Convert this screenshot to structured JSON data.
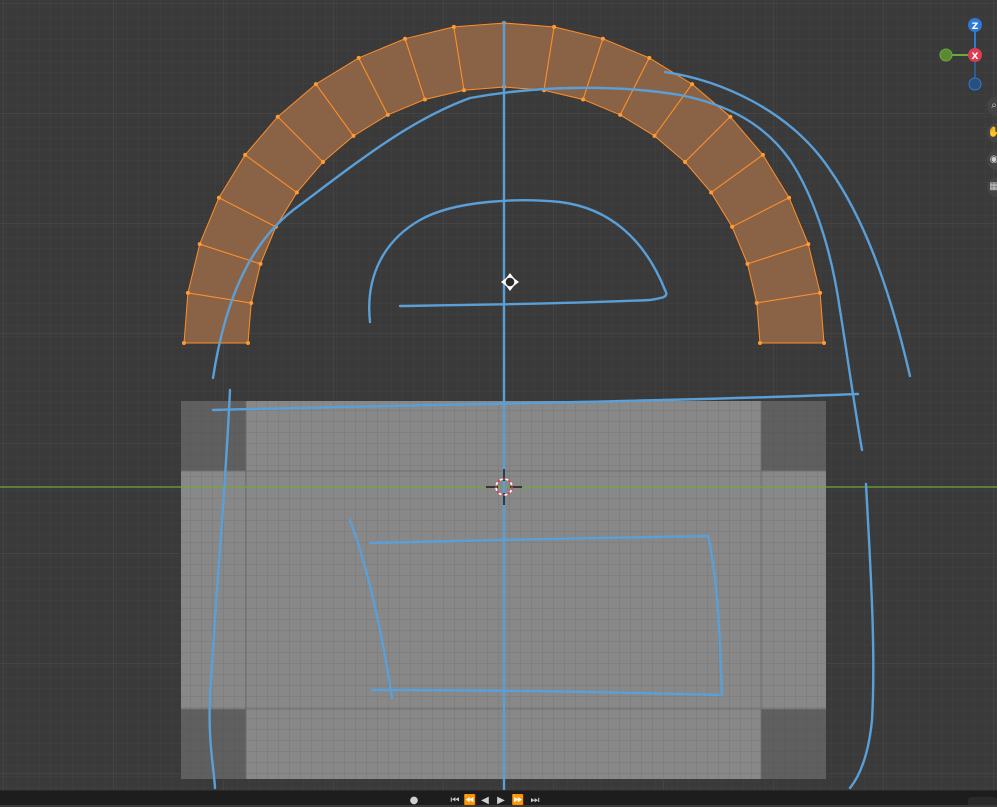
{
  "viewport": {
    "grid_color": "#444444",
    "background_color": "#3a3a3a",
    "x_axis_color": "#6ea83f"
  },
  "gizmo": {
    "axes": [
      "Z",
      "X",
      "Y"
    ],
    "z_color": "#2f78d6",
    "x_color": "#e03a53",
    "y_color": "#6ea83f"
  },
  "mesh_arch": {
    "fill_color": "#8a6347",
    "edge_color": "#ff8f2a",
    "vertex_color": "#ff9b32",
    "segments": 20
  },
  "mesh_base": {
    "fill_color": "#888888",
    "edge_color": "#6f6f6f",
    "corner_color": "#5f5f5f"
  },
  "annotation": {
    "stroke_color": "#5a9fd8"
  },
  "side_strip": {
    "icons": [
      "zoom-icon",
      "hand-icon",
      "camera-icon",
      "grid-view-icon"
    ]
  },
  "timeline": {
    "buttons": [
      "●",
      "⏮",
      "⏪",
      "◀",
      "▶",
      "⏩",
      "⏭"
    ]
  }
}
